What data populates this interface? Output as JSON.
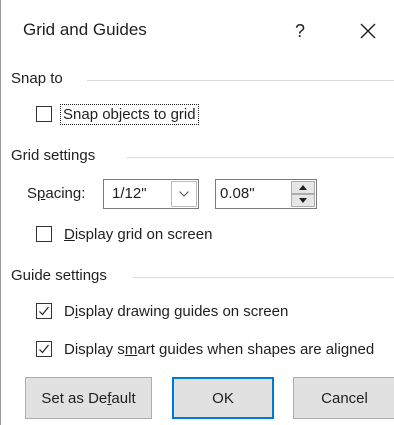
{
  "window": {
    "title": "Grid and Guides",
    "help_glyph": "?",
    "close_icon": "close-icon"
  },
  "snap_to": {
    "heading": "Snap to",
    "snap_objects_to_grid": {
      "label_pre": "Snap objects to ",
      "label_ul": "g",
      "label_post": "rid",
      "checked": false
    }
  },
  "grid_settings": {
    "heading": "Grid settings",
    "spacing_label_pre": "S",
    "spacing_label_ul": "p",
    "spacing_label_post": "acing:",
    "spacing_preset": "1/12\"",
    "spacing_value": "0.08\"",
    "display_grid": {
      "label_ul": "D",
      "label_post": "isplay grid on screen",
      "checked": false
    }
  },
  "guide_settings": {
    "heading": "Guide settings",
    "display_drawing_guides": {
      "label_pre": "D",
      "label_ul": "i",
      "label_post": "splay drawing guides on screen",
      "checked": true
    },
    "display_smart_guides": {
      "label_pre": "Display s",
      "label_ul": "m",
      "label_post": "art guides when shapes are aligned",
      "checked": true
    }
  },
  "buttons": {
    "set_default_pre": "Set as De",
    "set_default_ul": "f",
    "set_default_post": "ault",
    "ok": "OK",
    "cancel": "Cancel"
  },
  "colors": {
    "accent": "#0078d7",
    "button_face": "#e1e1e1",
    "divider": "#d9d9d9"
  }
}
